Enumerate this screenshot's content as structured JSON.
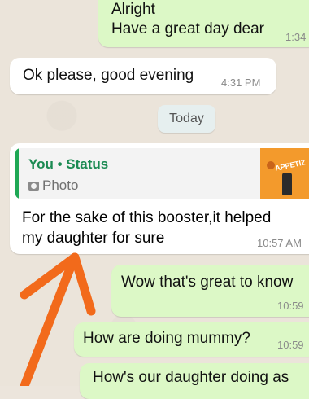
{
  "messages": [
    {
      "lines": [
        "Alright",
        "Have a great day dear"
      ],
      "time": "1:34"
    },
    {
      "text": "Ok please, good evening",
      "time": "4:31 PM"
    },
    {
      "quote_title": "You • Status",
      "quote_sub": "Photo",
      "thumb_text": "APPETIZ",
      "lines": [
        "For the sake of this booster,it helped",
        "my daughter for sure"
      ],
      "time": "10:57 AM"
    },
    {
      "text": "Wow that's great to know",
      "time": "10:59"
    },
    {
      "text": "How are doing mummy?",
      "time": "10:59"
    },
    {
      "text": "How's our daughter doing as"
    }
  ],
  "date_divider": "Today",
  "colors": {
    "outgoing": "#dcf8c6",
    "incoming": "#ffffff",
    "annotation_arrow": "#f26a1b",
    "status_accent": "#1fa855"
  }
}
